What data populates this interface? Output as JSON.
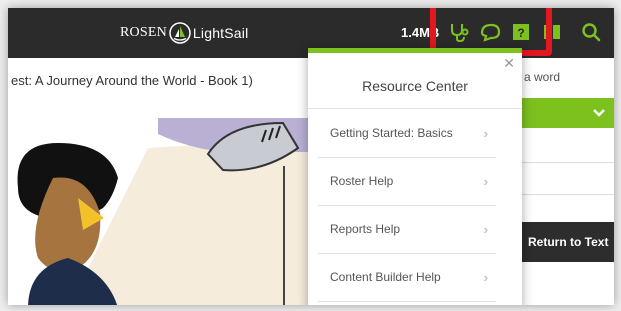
{
  "topbar": {
    "logo_brand": "ROSEN",
    "logo_product": "LightSail",
    "download_size": "1.4MB",
    "icons": [
      "stethoscope-icon",
      "chat-bubble-icon",
      "help-icon",
      "book-icon",
      "search-icon"
    ],
    "highlight_color": "#e2171f"
  },
  "page": {
    "book_title": "est: A Journey Around the World - Book 1)",
    "word_label": "a word",
    "return_button": "Return to Text",
    "accent_color": "#7dc11f"
  },
  "resource_center": {
    "title": "Resource Center",
    "items": [
      {
        "label": "Getting Started: Basics"
      },
      {
        "label": "Roster Help"
      },
      {
        "label": "Reports Help"
      },
      {
        "label": "Content Builder Help"
      }
    ]
  }
}
